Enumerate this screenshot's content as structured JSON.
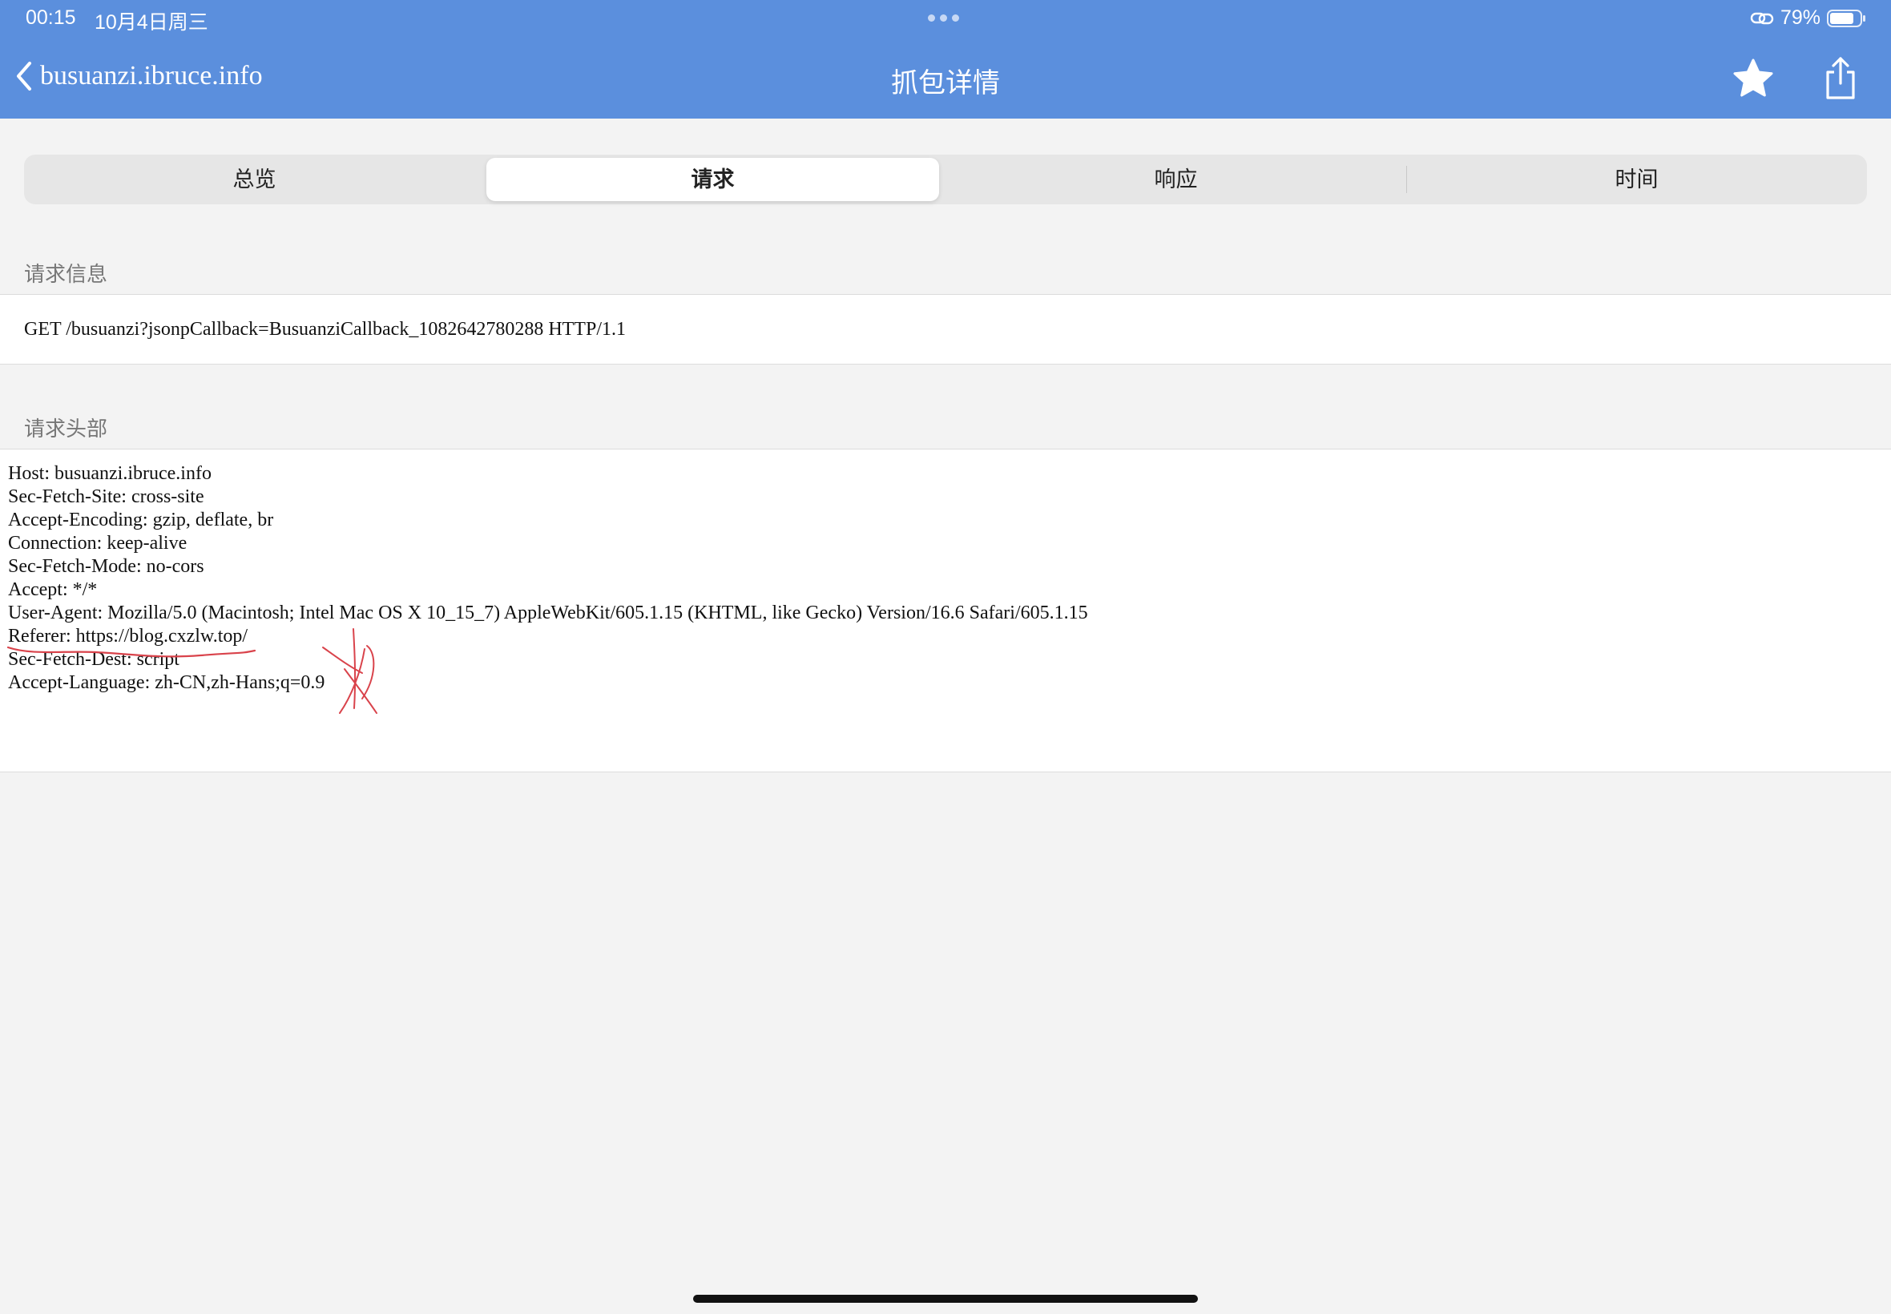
{
  "status_bar": {
    "time": "00:15",
    "date": "10月4日周三",
    "battery": "79%",
    "icons": [
      "link-icon",
      "battery-icon"
    ]
  },
  "nav": {
    "back_label": "busuanzi.ibruce.info",
    "title": "抓包详情",
    "icons": [
      "chevron-left-icon",
      "star-icon",
      "share-icon"
    ]
  },
  "tabs": [
    {
      "label": "总览",
      "active": false
    },
    {
      "label": "请求",
      "active": true
    },
    {
      "label": "响应",
      "active": false
    },
    {
      "label": "时间",
      "active": false
    }
  ],
  "request_info": {
    "header": "请求信息",
    "line": "GET /busuanzi?jsonpCallback=BusuanziCallback_1082642780288 HTTP/1.1"
  },
  "request_headers": {
    "header": "请求头部",
    "text": "Host: busuanzi.ibruce.info\nSec-Fetch-Site: cross-site\nAccept-Encoding: gzip, deflate, br\nConnection: keep-alive\nSec-Fetch-Mode: no-cors\nAccept: */*\nUser-Agent: Mozilla/5.0 (Macintosh; Intel Mac OS X 10_15_7) AppleWebKit/605.1.15 (KHTML, like Gecko) Version/16.6 Safari/605.1.15\nReferer: https://blog.cxzlw.top/\nSec-Fetch-Dest: script\nAccept-Language: zh-CN,zh-Hans;q=0.9"
  },
  "colors": {
    "nav_bar": "#5b8fdd",
    "background": "#f3f3f3",
    "annotation": "#d9434b"
  }
}
